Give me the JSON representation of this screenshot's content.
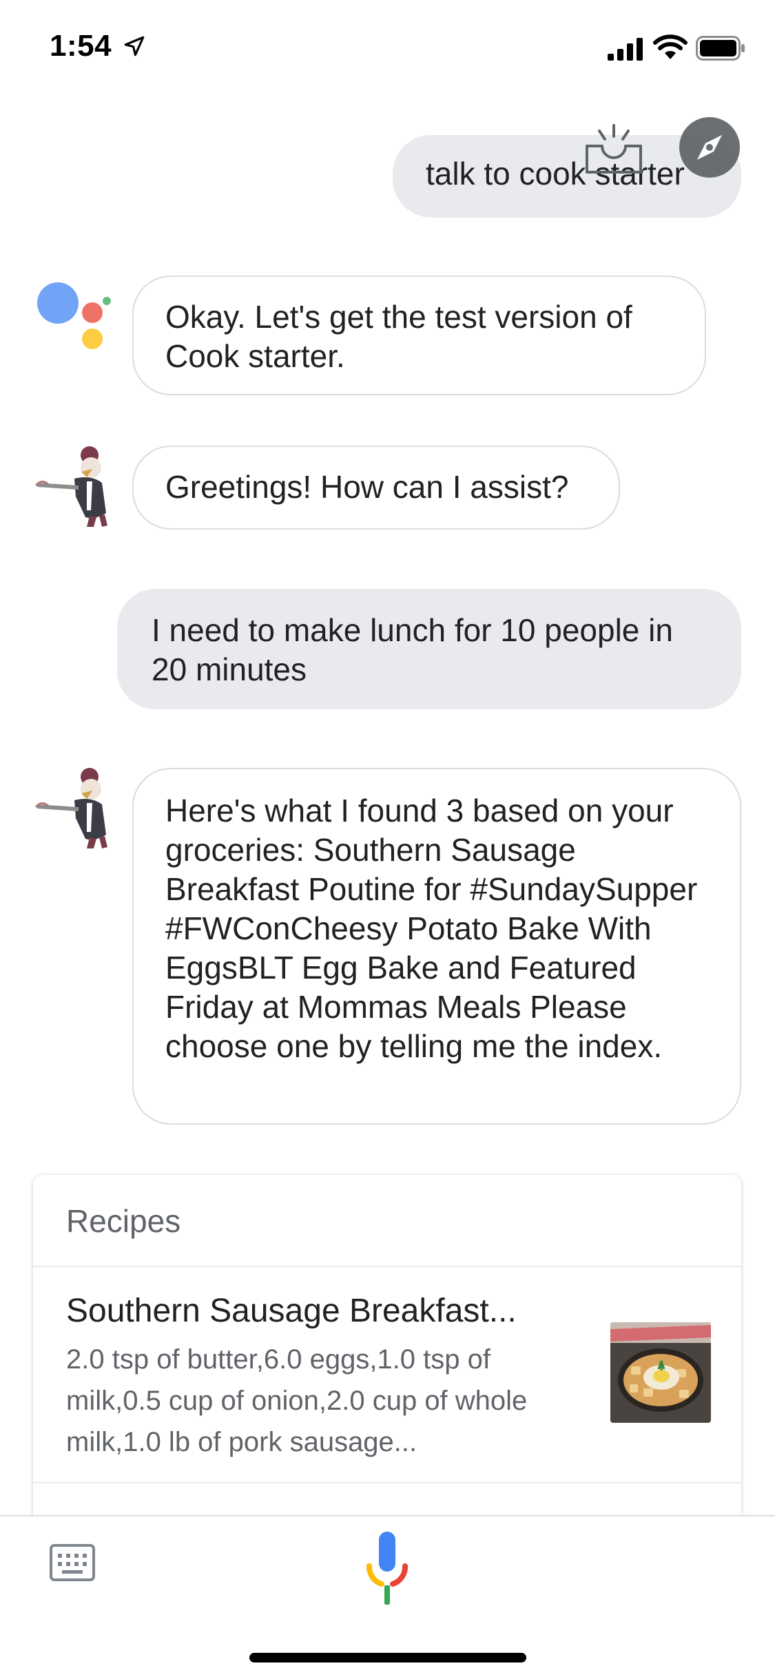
{
  "status_bar": {
    "time": "1:54",
    "location_icon": "location-arrow-icon",
    "signal_icon": "cellular-signal-icon",
    "wifi_icon": "wifi-icon",
    "battery_icon": "battery-icon"
  },
  "conversation": [
    {
      "role": "user",
      "text": "talk to cook starter"
    },
    {
      "role": "assistant",
      "text": "Okay. Let's get the test version of Cook starter."
    },
    {
      "role": "bot",
      "text": "Greetings! How can I assist?"
    },
    {
      "role": "user",
      "text": "I need to make lunch for 10 people in 20 minutes"
    },
    {
      "role": "bot",
      "text": "Here's what I found 3 based on your groceries: Southern Sausage Breakfast Poutine for #SundaySupper #FWConCheesy Potato Bake With EggsBLT Egg Bake and Featured Friday at Mommas Meals Please choose one by telling me the index."
    }
  ],
  "recipes_card": {
    "header": "Recipes",
    "items": [
      {
        "title": "Southern Sausage Breakfast...",
        "description": "2.0 tsp of butter,6.0 eggs,1.0 tsp of milk,0.5 cup of onion,2.0 cup of whole milk,1.0 lb of pork sausage..."
      }
    ]
  },
  "bottom_bar": {
    "keyboard_icon": "keyboard-icon",
    "mic_icon": "microphone-icon"
  },
  "colors": {
    "user_bubble": "#e8eaed",
    "bot_border": "#dadce0",
    "google_blue": "#4285f4",
    "google_red": "#ea4335",
    "google_yellow": "#fbbc04",
    "google_green": "#34a853"
  }
}
